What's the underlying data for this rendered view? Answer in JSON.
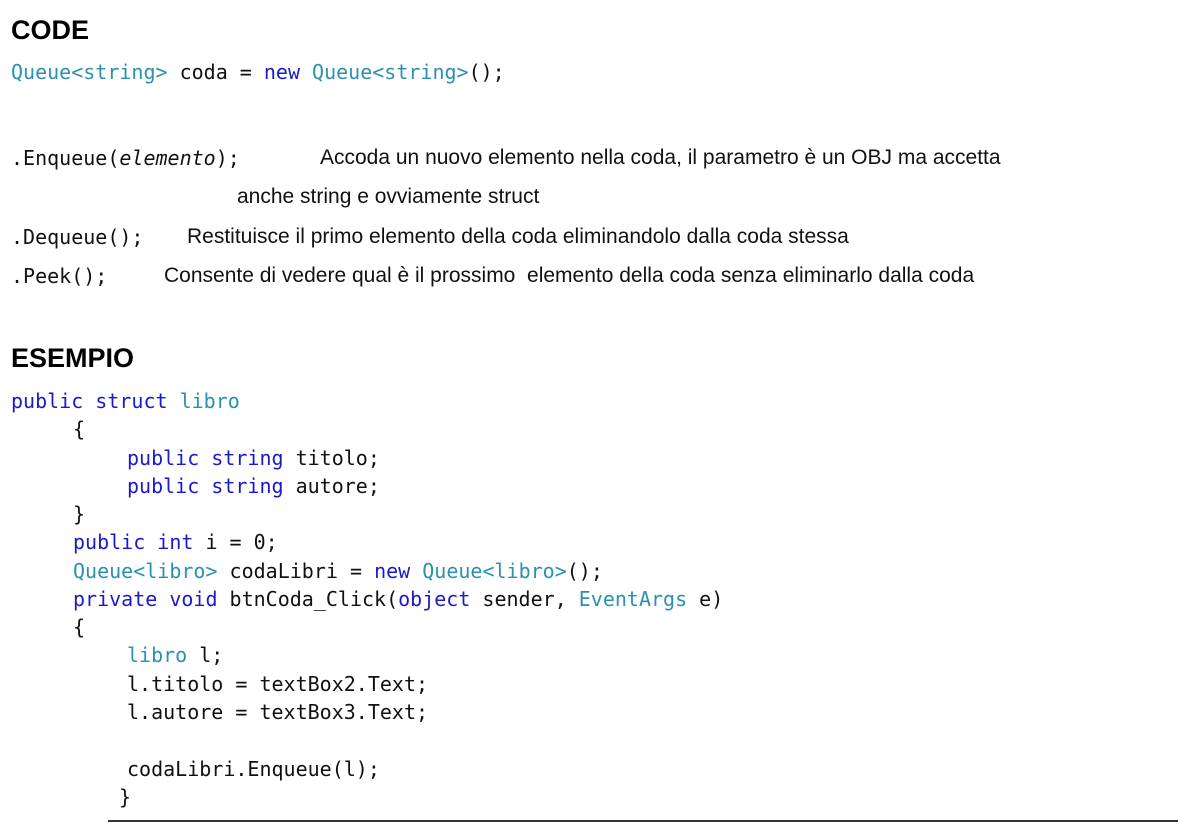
{
  "headings": {
    "code": "CODE",
    "example": "ESEMPIO"
  },
  "declaration": {
    "type1": "Queue",
    "generic1": "<string>",
    "var": " coda = ",
    "new_kw": "new",
    "type2": "Queue",
    "generic2": "<string>",
    "tail": "();"
  },
  "methods": {
    "enqueue": {
      "prefix": ".Enqueue(",
      "param": "elemento",
      "suffix": ");",
      "desc_line1": "Accoda un nuovo elemento nella coda, il parametro è un OBJ ma accetta",
      "desc_line2": "anche string e ovviamente struct"
    },
    "dequeue": {
      "sig": ".Dequeue();",
      "desc": "Restituisce il primo elemento della coda eliminandolo dalla coda stessa"
    },
    "peek": {
      "sig": ".Peek();",
      "desc": "Consente di vedere qual è il prossimo  elemento della coda senza eliminarlo dalla coda"
    }
  },
  "example": {
    "l1": {
      "kw1": "public",
      "kw2": "struct",
      "ty": "libro"
    },
    "l2": "{",
    "l3": {
      "kw1": "public",
      "kw2": "string",
      "rest": " titolo;"
    },
    "l4": {
      "kw1": "public",
      "kw2": "string",
      "rest": " autore;"
    },
    "l5": "}",
    "l6": {
      "kw1": "public",
      "kw2": "int",
      "rest": " i = 0;"
    },
    "l7": {
      "ty1": "Queue",
      "g1": "<libro>",
      "mid": " codaLibri = ",
      "kw": "new",
      "ty2": "Queue",
      "g2": "<libro>",
      "tail": "();"
    },
    "l8": {
      "kw1": "private",
      "kw2": "void",
      "mid": " btnCoda_Click(",
      "kw3": "object",
      "mid2": " sender, ",
      "ty": "EventArgs",
      "tail": " e)"
    },
    "l9": "{",
    "l10": {
      "ty": "libro",
      "rest": " l;"
    },
    "l11": "l.titolo = textBox2.Text;",
    "l12": "l.autore = textBox3.Text;",
    "l13": "codaLibri.Enqueue(l);",
    "l14": "}"
  },
  "colors": {
    "keyword": "#1a1acc",
    "type": "#2b91af",
    "text": "#111111"
  }
}
